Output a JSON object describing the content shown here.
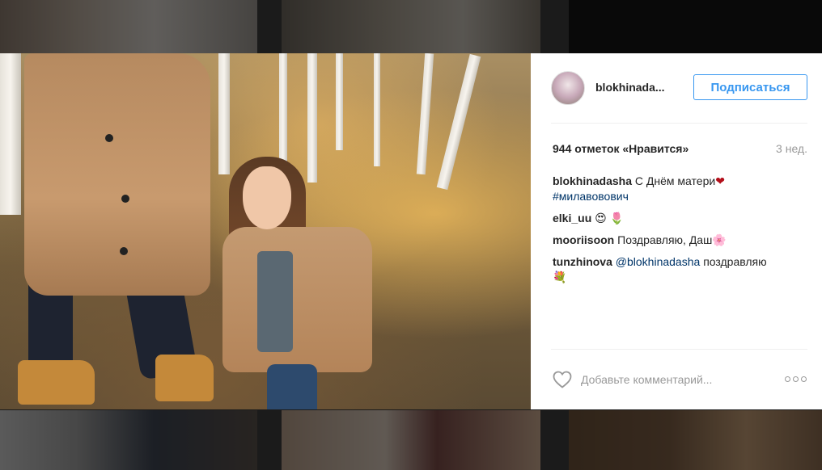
{
  "post": {
    "username": "blokhinada...",
    "follow_label": "Подписаться",
    "likes": "944 отметок «Нравится»",
    "time": "3 нед.",
    "comment_placeholder": "Добавьте комментарий..."
  },
  "comments": [
    {
      "author": "blokhinadasha",
      "text": "С Днём матери",
      "emoji": "❤",
      "hashtag": "#милавовович"
    },
    {
      "author": "elki_uu",
      "text": "😍 🌷"
    },
    {
      "author": "mooriisoon",
      "text": "Поздравляю, Даш🌸"
    },
    {
      "author": "tunzhinova",
      "mention": "@blokhinadasha",
      "text": "поздравляю",
      "emoji": "💐"
    }
  ],
  "icons": {
    "like": "heart-outline-icon",
    "more": "more-options-icon"
  },
  "colors": {
    "accent": "#3897f0",
    "hashtag": "#003569",
    "muted": "#999999",
    "text": "#262626"
  }
}
